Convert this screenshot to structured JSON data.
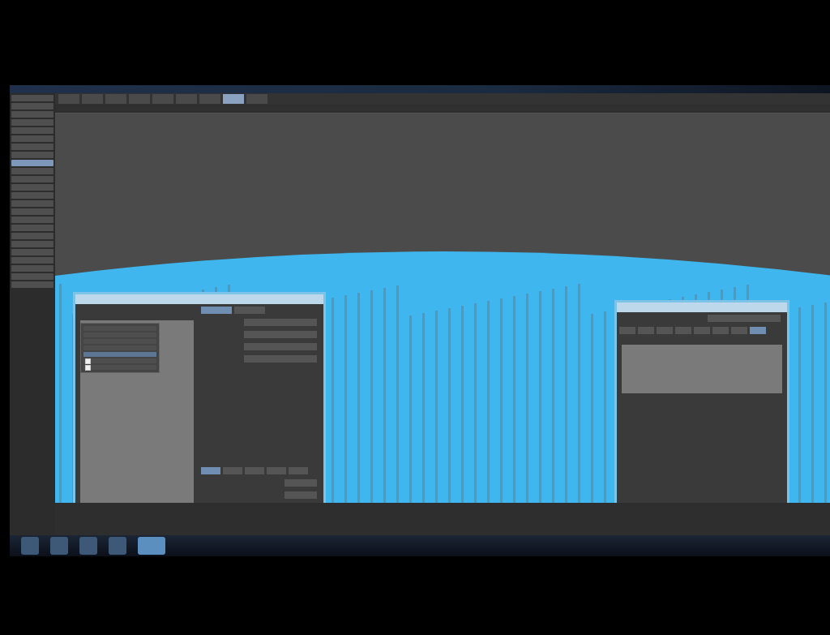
{
  "menu_tabs": [
    {
      "selected": false
    },
    {
      "selected": false
    },
    {
      "selected": false
    },
    {
      "selected": false
    },
    {
      "selected": false
    },
    {
      "selected": false
    },
    {
      "selected": false
    },
    {
      "selected": true
    },
    {
      "selected": false
    }
  ],
  "sidebar_buttons": [
    {
      "selected": false
    },
    {
      "selected": false
    },
    {
      "selected": false
    },
    {
      "selected": false
    },
    {
      "selected": false
    },
    {
      "selected": false
    },
    {
      "selected": false
    },
    {
      "selected": false
    },
    {
      "selected": true
    },
    {
      "selected": false
    },
    {
      "selected": false
    },
    {
      "selected": false
    },
    {
      "selected": false
    },
    {
      "selected": false
    },
    {
      "selected": false
    },
    {
      "selected": false
    },
    {
      "selected": false
    },
    {
      "selected": false
    },
    {
      "selected": false
    },
    {
      "selected": false
    },
    {
      "selected": false
    },
    {
      "selected": false
    },
    {
      "selected": false
    },
    {
      "selected": false
    }
  ],
  "left_dialog": {
    "tabs": [
      {
        "selected": true
      },
      {
        "selected": false
      }
    ],
    "subtabs": [
      {
        "selected": true
      },
      {
        "selected": false
      },
      {
        "selected": false
      },
      {
        "selected": false
      },
      {
        "selected": false
      }
    ]
  },
  "popup_menu": {
    "items": [
      {
        "kind": "plain",
        "selected": false
      },
      {
        "kind": "plain",
        "selected": false
      },
      {
        "kind": "plain",
        "selected": false
      },
      {
        "kind": "plain",
        "selected": false
      },
      {
        "kind": "plain",
        "selected": true
      },
      {
        "kind": "checkbox",
        "selected": false,
        "checked": true
      },
      {
        "kind": "checkbox",
        "selected": false,
        "checked": true
      }
    ]
  },
  "right_dialog": {
    "tabs": [
      {
        "selected": false
      },
      {
        "selected": false
      },
      {
        "selected": false
      },
      {
        "selected": false
      },
      {
        "selected": false
      },
      {
        "selected": false
      },
      {
        "selected": false
      },
      {
        "selected": true
      }
    ]
  },
  "taskbar": {
    "apps": [
      {
        "selected": false
      },
      {
        "selected": false
      },
      {
        "selected": false
      },
      {
        "selected": false
      },
      {
        "selected": true
      }
    ]
  }
}
